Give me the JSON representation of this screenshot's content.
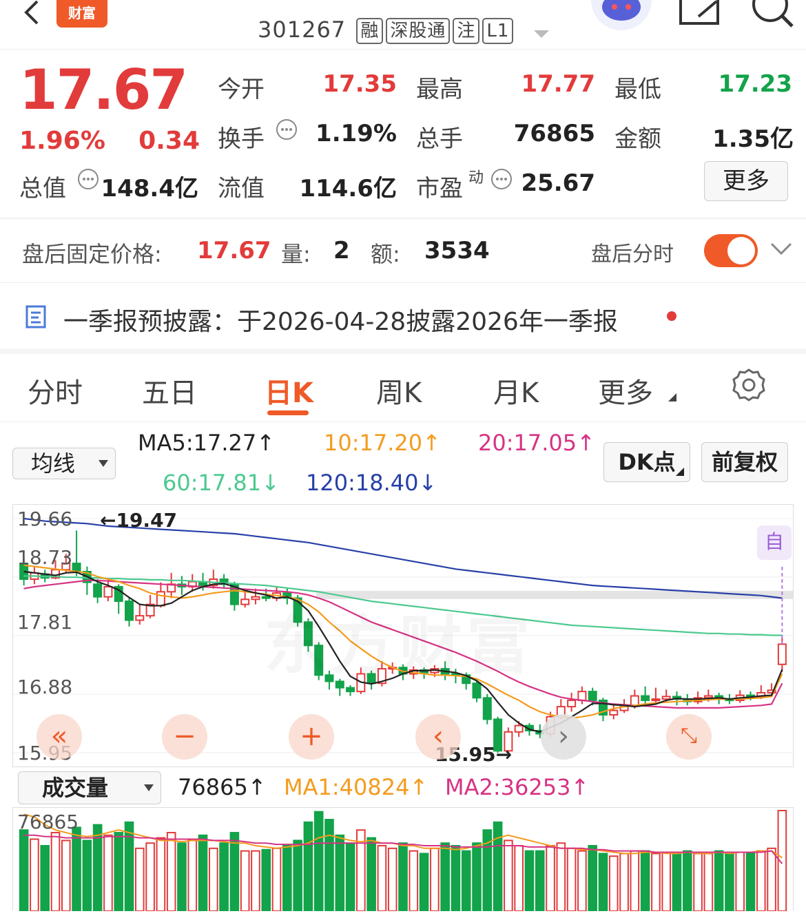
{
  "header": {
    "logo": "财富",
    "code": "301267",
    "tags": [
      "融",
      "深股通",
      "注",
      "L1"
    ]
  },
  "quote": {
    "price": "17.67",
    "pct": "1.96%",
    "change": "0.34",
    "stats": [
      {
        "label": "今开",
        "value": "17.35"
      },
      {
        "label": "最高",
        "value": "17.77"
      },
      {
        "label": "最低",
        "value": "17.23"
      },
      {
        "label": "换手",
        "value": "1.19%"
      },
      {
        "label": "总手",
        "value": "76865"
      },
      {
        "label": "金额",
        "value": "1.35亿"
      },
      {
        "label": "总值",
        "value": "148.4亿"
      },
      {
        "label": "流值",
        "value": "114.6亿"
      },
      {
        "label": "市盈",
        "sup": "动",
        "value": "25.67"
      }
    ],
    "more": "更多"
  },
  "after_hours": {
    "label": "盘后固定价格:",
    "price": "17.67",
    "vol_label": "量:",
    "vol": "2",
    "amt_label": "额:",
    "amt": "3534",
    "toggle_label": "盘后分时"
  },
  "notice": {
    "text": "一季报预披露：于2026-04-28披露2026年一季报"
  },
  "tabs": [
    "分时",
    "五日",
    "日K",
    "周K",
    "月K",
    "更多"
  ],
  "ma": {
    "select": "均线",
    "ma5": "MA5:17.27↑",
    "ma10": "10:17.20↑",
    "ma20": "20:17.05↑",
    "ma60": "60:17.81↓",
    "ma120": "120:18.40↓",
    "dk": "DK点",
    "adj": "前复权"
  },
  "colors": {
    "up": "#e23b3b",
    "down": "#13a34a",
    "ma5": "#222222",
    "ma10": "#f39c1e",
    "ma20": "#d63384",
    "ma60": "#4cc98f",
    "ma120": "#2740a8",
    "accent": "#ef5a28"
  },
  "kchart": {
    "y_labels": [
      "19.66",
      "18.73",
      "17.81",
      "16.88",
      "15.95"
    ],
    "high_mark": "←19.47",
    "low_mark": "15.95→",
    "auto": "自"
  },
  "volume": {
    "select": "成交量",
    "value": "76865↑",
    "ma1": "MA1:40824↑",
    "ma2": "MA2:36253↑",
    "y_label": "76865"
  },
  "chart_data": {
    "type": "candlestick",
    "ylim": [
      15.95,
      19.66
    ],
    "candles": [
      [
        18.95,
        18.7,
        19.05,
        18.6
      ],
      [
        18.7,
        18.8,
        18.9,
        18.62
      ],
      [
        18.78,
        18.72,
        18.85,
        18.65
      ],
      [
        18.72,
        18.85,
        19.0,
        18.7
      ],
      [
        18.85,
        18.95,
        19.1,
        18.8
      ],
      [
        18.95,
        18.82,
        19.47,
        18.75
      ],
      [
        18.82,
        18.65,
        18.9,
        18.45
      ],
      [
        18.62,
        18.42,
        18.7,
        18.32
      ],
      [
        18.42,
        18.58,
        18.7,
        18.35
      ],
      [
        18.58,
        18.35,
        18.62,
        18.15
      ],
      [
        18.35,
        18.05,
        18.4,
        17.95
      ],
      [
        18.05,
        18.12,
        18.3,
        17.98
      ],
      [
        18.12,
        18.3,
        18.45,
        18.08
      ],
      [
        18.28,
        18.5,
        18.65,
        18.25
      ],
      [
        18.5,
        18.62,
        18.8,
        18.4
      ],
      [
        18.62,
        18.58,
        18.75,
        18.45
      ],
      [
        18.58,
        18.66,
        18.78,
        18.5
      ],
      [
        18.66,
        18.6,
        18.8,
        18.52
      ],
      [
        18.6,
        18.7,
        18.85,
        18.55
      ],
      [
        18.7,
        18.62,
        18.78,
        18.55
      ],
      [
        18.62,
        18.3,
        18.66,
        18.2
      ],
      [
        18.3,
        18.38,
        18.5,
        18.25
      ],
      [
        18.38,
        18.42,
        18.55,
        18.3
      ],
      [
        18.42,
        18.4,
        18.55,
        18.35
      ],
      [
        18.4,
        18.48,
        18.58,
        18.35
      ],
      [
        18.48,
        18.4,
        18.55,
        18.3
      ],
      [
        18.4,
        18.02,
        18.45,
        17.95
      ],
      [
        18.02,
        17.65,
        18.08,
        17.55
      ],
      [
        17.65,
        17.18,
        17.7,
        17.1
      ],
      [
        17.18,
        17.08,
        17.25,
        16.95
      ],
      [
        17.08,
        16.98,
        17.12,
        16.85
      ],
      [
        16.98,
        16.92,
        17.02,
        16.85
      ],
      [
        16.92,
        17.2,
        17.3,
        16.88
      ],
      [
        17.2,
        17.05,
        17.25,
        16.95
      ],
      [
        17.05,
        17.28,
        17.4,
        17.0
      ],
      [
        17.28,
        17.3,
        17.38,
        17.2
      ],
      [
        17.3,
        17.2,
        17.35,
        17.1
      ],
      [
        17.2,
        17.26,
        17.32,
        17.12
      ],
      [
        17.26,
        17.22,
        17.3,
        17.12
      ],
      [
        17.22,
        17.28,
        17.34,
        17.15
      ],
      [
        17.28,
        17.2,
        17.4,
        17.1
      ],
      [
        17.2,
        17.18,
        17.28,
        17.05
      ],
      [
        17.18,
        17.05,
        17.22,
        16.95
      ],
      [
        17.05,
        16.82,
        17.1,
        16.75
      ],
      [
        16.82,
        16.48,
        16.88,
        16.4
      ],
      [
        16.48,
        15.98,
        16.52,
        15.95
      ],
      [
        15.98,
        16.28,
        16.35,
        15.96
      ],
      [
        16.28,
        16.38,
        16.45,
        16.2
      ],
      [
        16.38,
        16.3,
        16.42,
        16.22
      ],
      [
        16.3,
        16.25,
        16.4,
        16.18
      ],
      [
        16.25,
        16.52,
        16.6,
        16.2
      ],
      [
        16.52,
        16.68,
        16.8,
        16.48
      ],
      [
        16.68,
        16.78,
        16.9,
        16.6
      ],
      [
        16.78,
        16.92,
        17.0,
        16.72
      ],
      [
        16.92,
        16.78,
        16.98,
        16.7
      ],
      [
        16.78,
        16.55,
        16.82,
        16.45
      ],
      [
        16.55,
        16.62,
        16.7,
        16.48
      ],
      [
        16.62,
        16.7,
        16.8,
        16.58
      ],
      [
        16.7,
        16.85,
        16.95,
        16.65
      ],
      [
        16.85,
        16.78,
        17.0,
        16.72
      ],
      [
        16.78,
        16.8,
        16.98,
        16.72
      ],
      [
        16.8,
        16.84,
        16.95,
        16.75
      ],
      [
        16.84,
        16.8,
        16.92,
        16.7
      ],
      [
        16.8,
        16.76,
        16.88,
        16.7
      ],
      [
        16.76,
        16.82,
        16.92,
        16.72
      ],
      [
        16.82,
        16.85,
        16.95,
        16.76
      ],
      [
        16.85,
        16.8,
        16.9,
        16.72
      ],
      [
        16.8,
        16.78,
        16.88,
        16.72
      ],
      [
        16.78,
        16.86,
        16.94,
        16.74
      ],
      [
        16.86,
        16.84,
        16.92,
        16.78
      ],
      [
        16.84,
        16.9,
        17.02,
        16.8
      ],
      [
        16.9,
        16.94,
        17.05,
        16.86
      ],
      [
        17.35,
        17.67,
        17.77,
        17.23
      ]
    ],
    "ma5": [
      18.82,
      18.8,
      18.78,
      18.76,
      18.8,
      18.81,
      18.74,
      18.66,
      18.6,
      18.53,
      18.41,
      18.3,
      18.28,
      18.28,
      18.32,
      18.42,
      18.52,
      18.58,
      18.62,
      18.63,
      18.58,
      18.52,
      18.48,
      18.45,
      18.4,
      18.42,
      18.35,
      18.2,
      17.95,
      17.68,
      17.4,
      17.16,
      17.07,
      17.04,
      17.08,
      17.13,
      17.2,
      17.25,
      17.25,
      17.26,
      17.24,
      17.22,
      17.17,
      17.09,
      16.96,
      16.75,
      16.55,
      16.42,
      16.32,
      16.28,
      16.35,
      16.42,
      16.52,
      16.62,
      16.73,
      16.73,
      16.71,
      16.7,
      16.68,
      16.7,
      16.72,
      16.78,
      16.81,
      16.8,
      16.8,
      16.81,
      16.82,
      16.8,
      16.82,
      16.83,
      16.85,
      16.86,
      17.27
    ],
    "ma10": [
      18.92,
      18.9,
      18.88,
      18.86,
      18.84,
      18.82,
      18.8,
      18.74,
      18.7,
      18.66,
      18.6,
      18.55,
      18.48,
      18.44,
      18.42,
      18.4,
      18.42,
      18.45,
      18.48,
      18.5,
      18.52,
      18.5,
      18.48,
      18.46,
      18.44,
      18.42,
      18.38,
      18.3,
      18.18,
      18.02,
      17.88,
      17.72,
      17.6,
      17.48,
      17.38,
      17.3,
      17.24,
      17.22,
      17.2,
      17.18,
      17.18,
      17.17,
      17.16,
      17.12,
      17.04,
      16.95,
      16.86,
      16.78,
      16.68,
      16.6,
      16.55,
      16.52,
      16.5,
      16.52,
      16.55,
      16.6,
      16.65,
      16.68,
      16.7,
      16.72,
      16.74,
      16.75,
      16.76,
      16.77,
      16.78,
      16.79,
      16.8,
      16.8,
      16.8,
      16.81,
      16.82,
      16.84,
      17.2
    ],
    "ma20": [
      18.55,
      18.58,
      18.6,
      18.62,
      18.64,
      18.66,
      18.68,
      18.68,
      18.67,
      18.66,
      18.65,
      18.64,
      18.63,
      18.62,
      18.61,
      18.6,
      18.59,
      18.58,
      18.57,
      18.56,
      18.55,
      18.54,
      18.53,
      18.52,
      18.51,
      18.5,
      18.48,
      18.45,
      18.4,
      18.34,
      18.26,
      18.18,
      18.1,
      18.02,
      17.96,
      17.9,
      17.84,
      17.78,
      17.72,
      17.66,
      17.6,
      17.54,
      17.47,
      17.4,
      17.32,
      17.24,
      17.15,
      17.07,
      17.0,
      16.94,
      16.88,
      16.83,
      16.8,
      16.78,
      16.76,
      16.74,
      16.72,
      16.71,
      16.7,
      16.69,
      16.68,
      16.67,
      16.66,
      16.66,
      16.66,
      16.66,
      16.66,
      16.67,
      16.68,
      16.69,
      16.7,
      16.72,
      17.05
    ],
    "ma60": [
      18.75,
      18.75,
      18.74,
      18.74,
      18.73,
      18.73,
      18.72,
      18.72,
      18.71,
      18.71,
      18.7,
      18.7,
      18.69,
      18.69,
      18.68,
      18.68,
      18.67,
      18.66,
      18.65,
      18.64,
      18.63,
      18.62,
      18.61,
      18.6,
      18.58,
      18.56,
      18.54,
      18.52,
      18.5,
      18.47,
      18.44,
      18.41,
      18.38,
      18.35,
      18.33,
      18.31,
      18.29,
      18.27,
      18.25,
      18.23,
      18.21,
      18.19,
      18.17,
      18.15,
      18.13,
      18.11,
      18.09,
      18.07,
      18.05,
      18.03,
      18.01,
      17.99,
      17.97,
      17.96,
      17.95,
      17.94,
      17.93,
      17.92,
      17.91,
      17.9,
      17.89,
      17.88,
      17.87,
      17.86,
      17.85,
      17.84,
      17.84,
      17.83,
      17.83,
      17.82,
      17.82,
      17.81,
      17.81
    ],
    "ma120": [
      19.66,
      19.64,
      19.62,
      19.61,
      19.6,
      19.59,
      19.58,
      19.56,
      19.54,
      19.53,
      19.52,
      19.51,
      19.5,
      19.49,
      19.48,
      19.47,
      19.46,
      19.45,
      19.44,
      19.43,
      19.42,
      19.4,
      19.38,
      19.36,
      19.34,
      19.32,
      19.3,
      19.28,
      19.25,
      19.22,
      19.19,
      19.16,
      19.13,
      19.1,
      19.07,
      19.04,
      19.01,
      18.98,
      18.95,
      18.92,
      18.89,
      18.86,
      18.84,
      18.82,
      18.8,
      18.78,
      18.76,
      18.74,
      18.72,
      18.7,
      18.68,
      18.66,
      18.64,
      18.62,
      18.6,
      18.59,
      18.58,
      18.57,
      18.56,
      18.55,
      18.54,
      18.53,
      18.52,
      18.51,
      18.5,
      18.49,
      18.48,
      18.47,
      18.46,
      18.45,
      18.44,
      18.42,
      18.4
    ],
    "volumes": [
      62000,
      55000,
      50000,
      60000,
      54000,
      64000,
      54000,
      66000,
      58000,
      60000,
      68000,
      48000,
      52000,
      56000,
      60000,
      52000,
      54000,
      58000,
      48000,
      52000,
      60000,
      46000,
      46000,
      47000,
      48000,
      50000,
      54000,
      68000,
      76000,
      70000,
      58000,
      52000,
      62000,
      56000,
      50000,
      48000,
      52000,
      46000,
      44000,
      48000,
      52000,
      50000,
      46000,
      52000,
      62000,
      68000,
      54000,
      50000,
      46000,
      46000,
      50000,
      52000,
      48000,
      46000,
      50000,
      44000,
      42000,
      44000,
      46000,
      46000,
      44000,
      45000,
      44000,
      46000,
      44000,
      44000,
      46000,
      44000,
      45000,
      44000,
      46000,
      48000,
      76865
    ],
    "vol_ma1": [
      74000,
      72000,
      66000,
      62000,
      60000,
      58000,
      57000,
      58000,
      60000,
      62000,
      60000,
      58000,
      56000,
      54000,
      54000,
      53000,
      54000,
      54000,
      54000,
      53000,
      52000,
      52000,
      50000,
      49000,
      48000,
      49000,
      50000,
      52000,
      56000,
      58000,
      56000,
      54000,
      53000,
      54000,
      52000,
      52000,
      50000,
      50000,
      48000,
      48000,
      48000,
      47000,
      48000,
      50000,
      52000,
      56000,
      58000,
      56000,
      54000,
      52000,
      50000,
      48000,
      48000,
      47000,
      47000,
      46000,
      45000,
      44000,
      44000,
      45000,
      45000,
      44000,
      44000,
      45000,
      44000,
      44000,
      45000,
      44000,
      45000,
      45000,
      46000,
      46000,
      40824
    ],
    "vol_ma2": [
      58000,
      58000,
      57000,
      57000,
      56000,
      56000,
      56000,
      56000,
      57000,
      57000,
      57000,
      56000,
      56000,
      55000,
      55000,
      55000,
      55000,
      55000,
      54000,
      54000,
      54000,
      53000,
      52000,
      52000,
      51000,
      51000,
      51000,
      51000,
      52000,
      52000,
      52000,
      52000,
      52000,
      52000,
      52000,
      52000,
      51000,
      51000,
      50000,
      50000,
      50000,
      49000,
      49000,
      49000,
      49000,
      50000,
      50000,
      50000,
      49000,
      49000,
      49000,
      48000,
      48000,
      48000,
      47000,
      47000,
      46000,
      46000,
      46000,
      46000,
      45000,
      45000,
      45000,
      45000,
      45000,
      45000,
      45000,
      45000,
      45000,
      45000,
      45000,
      46000,
      36253
    ]
  }
}
